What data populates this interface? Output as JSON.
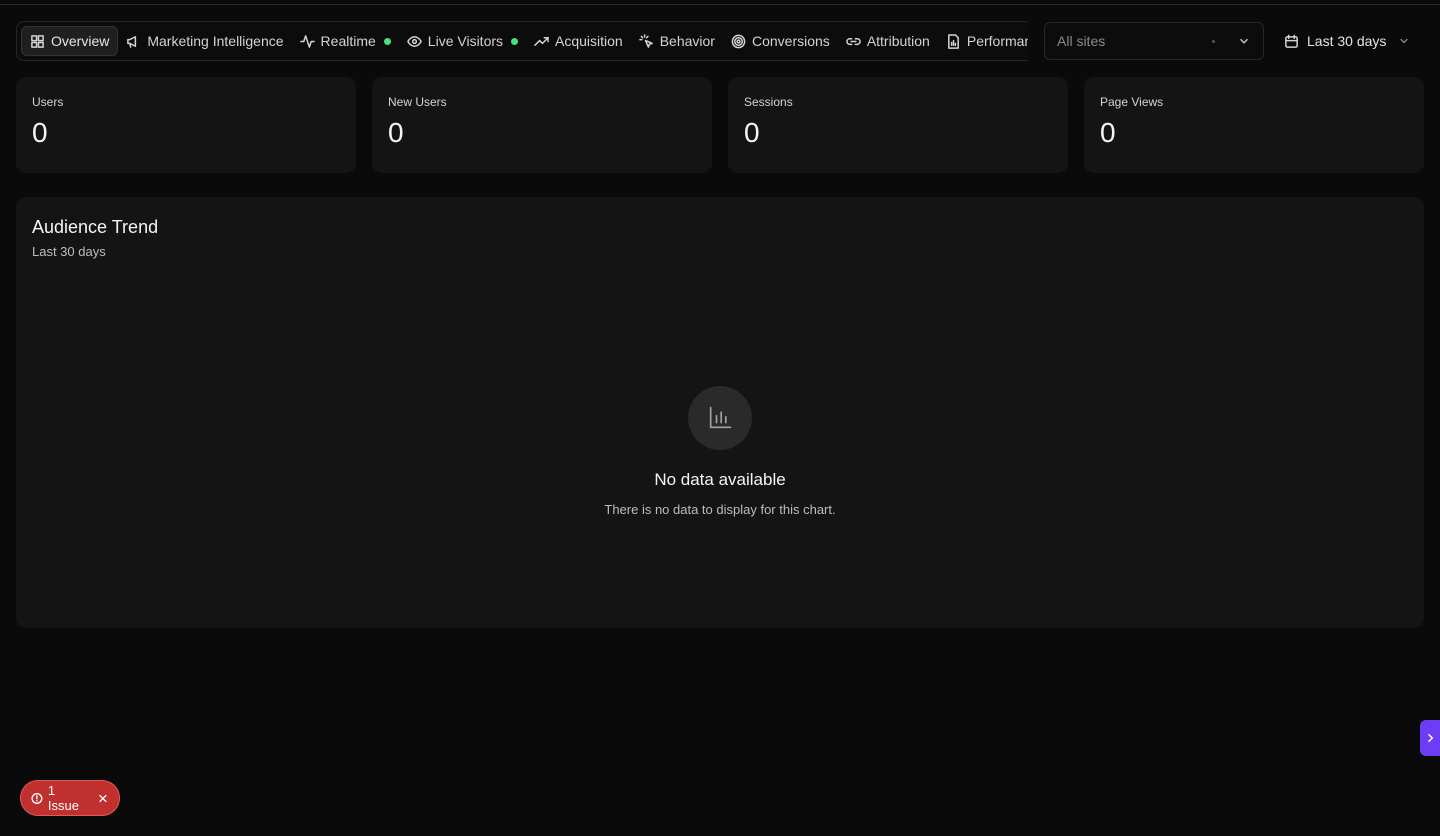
{
  "tabs": [
    {
      "label": "Overview",
      "icon": "grid-icon",
      "active": true
    },
    {
      "label": "Marketing Intelligence",
      "icon": "megaphone-icon"
    },
    {
      "label": "Realtime",
      "icon": "activity-icon",
      "live": true
    },
    {
      "label": "Live Visitors",
      "icon": "eye-icon",
      "live": true
    },
    {
      "label": "Acquisition",
      "icon": "trending-up-icon"
    },
    {
      "label": "Behavior",
      "icon": "pointer-click-icon"
    },
    {
      "label": "Conversions",
      "icon": "target-icon"
    },
    {
      "label": "Attribution",
      "icon": "link-icon"
    },
    {
      "label": "Performance",
      "icon": "file-chart-icon"
    }
  ],
  "site_select": {
    "value": "All sites"
  },
  "date_range": {
    "label": "Last 30 days"
  },
  "stats": [
    {
      "label": "Users",
      "value": "0"
    },
    {
      "label": "New Users",
      "value": "0"
    },
    {
      "label": "Sessions",
      "value": "0"
    },
    {
      "label": "Page Views",
      "value": "0"
    }
  ],
  "audience_chart": {
    "title": "Audience Trend",
    "subtitle": "Last 30 days",
    "empty_title": "No data available",
    "empty_message": "There is no data to display for this chart."
  },
  "issue_badge": {
    "label": "1 Issue"
  },
  "colors": {
    "accent": "#6d3df5",
    "live": "#4ade80",
    "issue": "#c0302f"
  }
}
